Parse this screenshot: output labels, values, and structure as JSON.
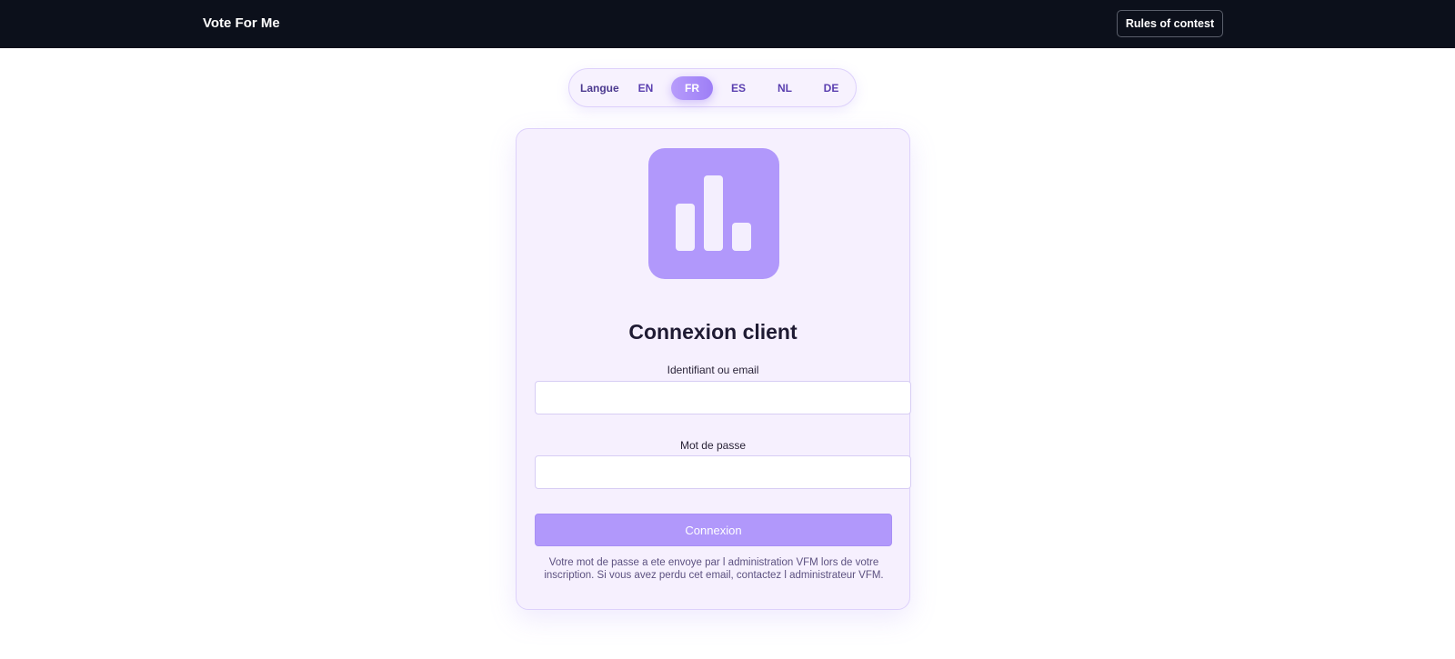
{
  "header": {
    "brand": "Vote For Me",
    "rules_label": "Rules of contest"
  },
  "language": {
    "label": "Langue",
    "options": [
      "EN",
      "FR",
      "ES",
      "NL",
      "DE"
    ],
    "selected": "FR"
  },
  "login": {
    "logo_icon": "bar-chart-icon",
    "title": "Connexion client",
    "username_label": "Identifiant ou email",
    "username_value": "",
    "password_label": "Mot de passe",
    "password_value": "",
    "submit_label": "Connexion",
    "help_text": "Votre mot de passe a ete envoye par l administration VFM lors de votre inscription. Si vous avez perdu cet email, contactez l administrateur VFM."
  },
  "colors": {
    "header_bg": "#0c101b",
    "accent": "#b198fb",
    "card_bg": "#f6f0fe"
  }
}
